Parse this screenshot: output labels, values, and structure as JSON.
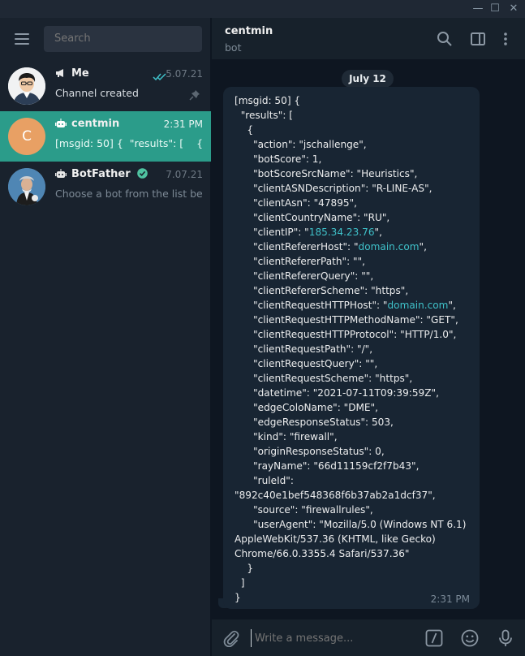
{
  "window": {
    "minimize_glyph": "—",
    "maximize_glyph": "☐",
    "close_glyph": "✕"
  },
  "sidebar": {
    "search_placeholder": "Search",
    "chats": [
      {
        "title": "Me",
        "type_icon": "megaphone-icon",
        "time": "5.07.21",
        "preview": "Channel created",
        "status_icon": "double-check-icon",
        "pinned": true
      },
      {
        "title": "centmin",
        "type_icon": "bot-icon",
        "time": "2:31 PM",
        "preview": "[msgid: 50] {  \"results\": [    {    ...",
        "avatar_letter": "C",
        "avatar_color": "#e8a064",
        "active": true
      },
      {
        "title": "BotFather",
        "type_icon": "bot-icon",
        "verified": true,
        "time": "7.07.21",
        "preview": "Choose a bot from the list be..."
      }
    ]
  },
  "header": {
    "title": "centmin",
    "subtitle": "bot"
  },
  "conversation": {
    "date_label": "July 12",
    "message": {
      "lines": [
        "[msgid: 50] {",
        "  \"results\": [",
        "    {",
        "      \"action\": \"jschallenge\",",
        "      \"botScore\": 1,",
        "      \"botScoreSrcName\": \"Heuristics\",",
        "      \"clientASNDescription\": \"R-LINE-AS\",",
        "      \"clientAsn\": \"47895\",",
        "      \"clientCountryName\": \"RU\",",
        "      \"clientIP\": \"185.34.23.76\",",
        "      \"clientRefererHost\": \"domain.com\",",
        "      \"clientRefererPath\": \"\",",
        "      \"clientRefererQuery\": \"\",",
        "      \"clientRefererScheme\": \"https\",",
        "      \"clientRequestHTTPHost\": \"domain.com\",",
        "      \"clientRequestHTTPMethodName\": \"GET\",",
        "      \"clientRequestHTTPProtocol\": \"HTTP/1.0\",",
        "      \"clientRequestPath\": \"/\",",
        "      \"clientRequestQuery\": \"\",",
        "      \"clientRequestScheme\": \"https\",",
        "      \"datetime\": \"2021-07-11T09:39:59Z\",",
        "      \"edgeColoName\": \"DME\",",
        "      \"edgeResponseStatus\": 503,",
        "      \"kind\": \"firewall\",",
        "      \"originResponseStatus\": 0,",
        "      \"rayName\": \"66d11159cf2f7b43\",",
        "      \"ruleId\":",
        "\"892c40e1bef548368f6b37ab2a1dcf37\",",
        "      \"source\": \"firewallrules\",",
        "      \"userAgent\": \"Mozilla/5.0 (Windows NT 6.1)",
        "AppleWebKit/537.36 (KHTML, like Gecko)",
        "Chrome/66.0.3355.4 Safari/537.36\"",
        "    }",
        "  ]",
        "}"
      ],
      "links": [
        "185.34.23.76",
        "domain.com"
      ],
      "time": "2:31 PM"
    }
  },
  "composer": {
    "placeholder": "Write a message..."
  },
  "colors": {
    "accent": "#2b9c8a",
    "link": "#3fc1c9",
    "verified": "#4fc3a1"
  }
}
